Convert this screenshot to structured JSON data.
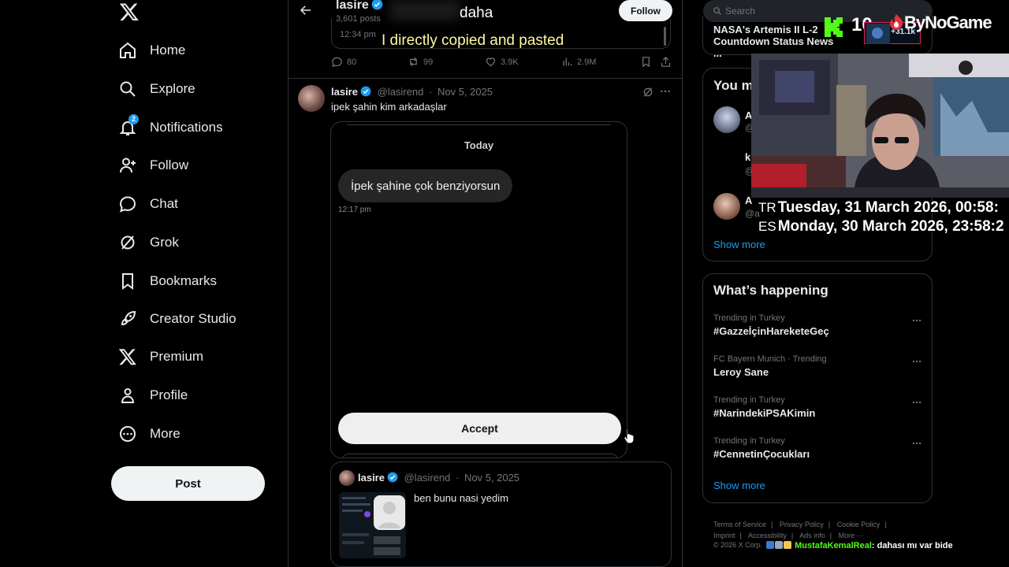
{
  "nav": {
    "items": [
      {
        "label": "Home",
        "icon": "home-icon"
      },
      {
        "label": "Explore",
        "icon": "search-icon"
      },
      {
        "label": "Notifications",
        "icon": "bell-icon",
        "badge": "2"
      },
      {
        "label": "Follow",
        "icon": "add-user-icon"
      },
      {
        "label": "Chat",
        "icon": "chat-icon"
      },
      {
        "label": "Grok",
        "icon": "grok-icon"
      },
      {
        "label": "Bookmarks",
        "icon": "bookmark-icon"
      },
      {
        "label": "Creator Studio",
        "icon": "rocket-icon"
      },
      {
        "label": "Premium",
        "icon": "x-logo-icon"
      },
      {
        "label": "Profile",
        "icon": "person-icon"
      },
      {
        "label": "More",
        "icon": "more-circle-icon"
      }
    ],
    "post_label": "Post"
  },
  "profile_header": {
    "name": "lasire",
    "posts": "3,601 posts",
    "follow_label": "Follow"
  },
  "quoted_top": {
    "time": "12:34 pm"
  },
  "actions": {
    "replies": "80",
    "reposts": "99",
    "likes": "3.9K",
    "views": "2.9M"
  },
  "post": {
    "name": "lasire",
    "handle": "@lasirend",
    "date": "Nov 5, 2025",
    "text": "ipek şahin kim arkadaşlar",
    "media": {
      "day": "Today",
      "message": "İpek şahine çok benziyorsun",
      "message_time": "12:17 pm",
      "accept_label": "Accept"
    }
  },
  "quote": {
    "name": "lasire",
    "handle": "@lasirend",
    "date": "Nov 5, 2025",
    "text": "ben bunu nasi yedim"
  },
  "sidebar": {
    "search_placeholder": "Search",
    "news_title": "NASA's Artemis II L-2 Countdown Status News ...",
    "wtf": {
      "title": "You m",
      "users": [
        {
          "name": "A",
          "handle": "@"
        },
        {
          "name": "k",
          "handle": "@"
        },
        {
          "name": "A",
          "handle": "@a"
        }
      ],
      "show_more": "Show more"
    },
    "happening": {
      "title": "What’s happening",
      "trends": [
        {
          "context": "Trending in Turkey",
          "topic": "#GazzeİçinHareketeGeç"
        },
        {
          "context": "FC Bayern Munich · Trending",
          "topic": "Leroy Sane"
        },
        {
          "context": "Trending in Turkey",
          "topic": "#NarindekiPSAKimin"
        },
        {
          "context": "Trending in Turkey",
          "topic": "#CennetinÇocukları"
        }
      ],
      "show_more": "Show more"
    },
    "footer": {
      "links": [
        "Terms of Service",
        "Privacy Policy",
        "Cookie Policy"
      ],
      "links2": [
        "Imprint",
        "Accessibility",
        "Ads info",
        "More ···"
      ],
      "copyright": "© 2026 X Corp."
    }
  },
  "overlay": {
    "caption1": "daha",
    "caption2": "I directly copied and pasted",
    "kick_count": "10",
    "thumb_count": "+31.1k",
    "brand": "ByNoGame",
    "clock_tr_tag": "TR",
    "clock_tr": "Tuesday, 31 March 2026, 00:58:",
    "clock_es_tag": "ES",
    "clock_es": "Monday, 30 March 2026, 23:58:2",
    "chat_user": "MustafaKemalReal",
    "chat_message": ": dahası mı var bide"
  },
  "colors": {
    "accent": "#1d9bf0",
    "kick_green": "#53fc18",
    "background": "#000000",
    "border": "#2f3336"
  }
}
